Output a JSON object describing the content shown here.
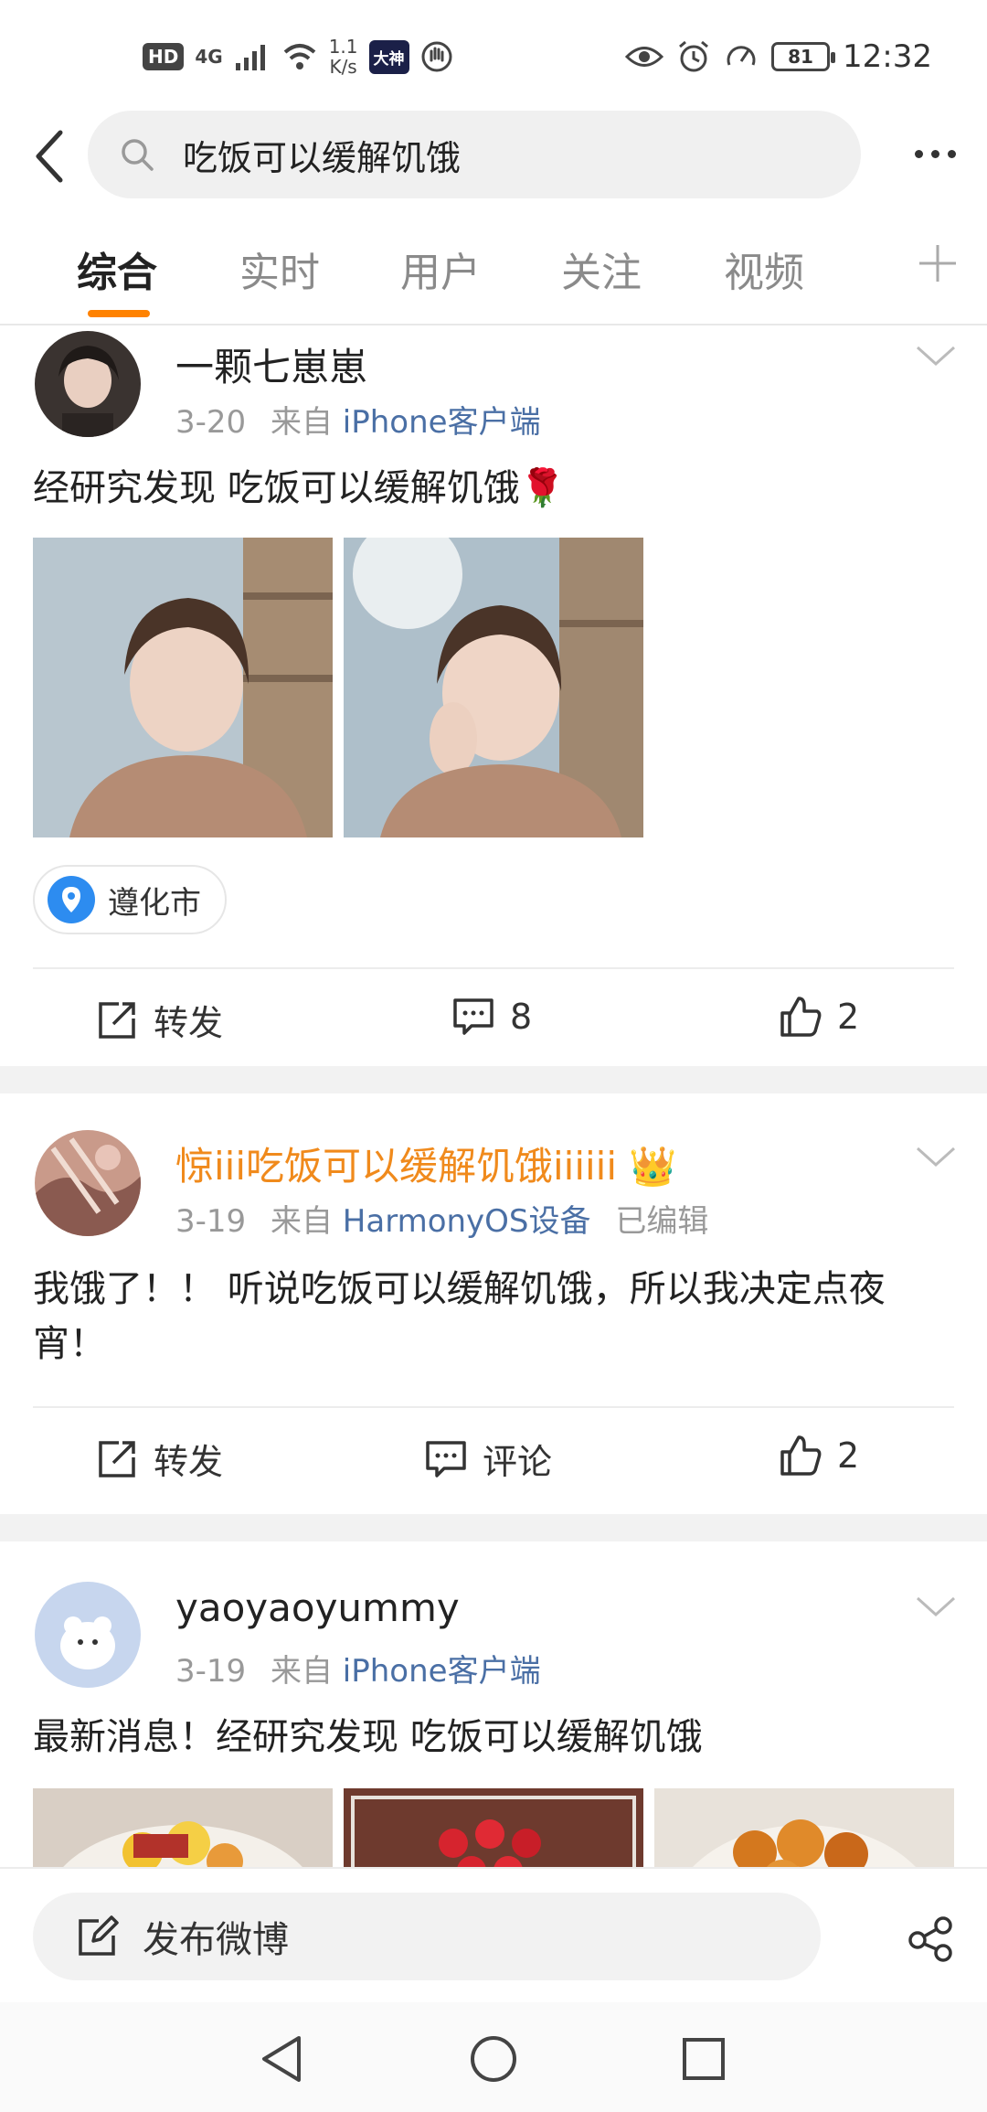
{
  "status_bar": {
    "hd": "HD",
    "network": "4G",
    "speed_value": "1.1",
    "speed_unit": "K/s",
    "app_badge": "大神",
    "battery": "81",
    "time": "12:32"
  },
  "search": {
    "query": "吃饭可以缓解饥饿"
  },
  "tabs": [
    {
      "label": "综合",
      "active": true
    },
    {
      "label": "实时",
      "active": false
    },
    {
      "label": "用户",
      "active": false
    },
    {
      "label": "关注",
      "active": false
    },
    {
      "label": "视频",
      "active": false
    }
  ],
  "posts": [
    {
      "author": "一颗七崽崽",
      "date": "3-20",
      "from_prefix": "来自",
      "source": "iPhone客户端",
      "text": "经研究发现 吃饭可以缓解饥饿🌹",
      "location": "遵化市",
      "repost_label": "转发",
      "comment_label": "8",
      "like_count": "2"
    },
    {
      "author": "惊iii吃饭可以缓解饥饿iiiiii 👑",
      "date": "3-19",
      "from_prefix": "来自",
      "source": "HarmonyOS设备",
      "edited": "已编辑",
      "text": "我饿了！！ 听说吃饭可以缓解饥饿，所以我决定点夜宵！",
      "repost_label": "转发",
      "comment_label": "评论",
      "like_count": "2"
    },
    {
      "author": "yaoyaoyummy",
      "date": "3-19",
      "from_prefix": "来自",
      "source": "iPhone客户端",
      "text": "最新消息！经研究发现 吃饭可以缓解饥饿"
    }
  ],
  "compose": {
    "label": "发布微博"
  },
  "colors": {
    "accent": "#ff8200",
    "link": "#4a6fa5",
    "vip_name": "#f08a1c"
  }
}
